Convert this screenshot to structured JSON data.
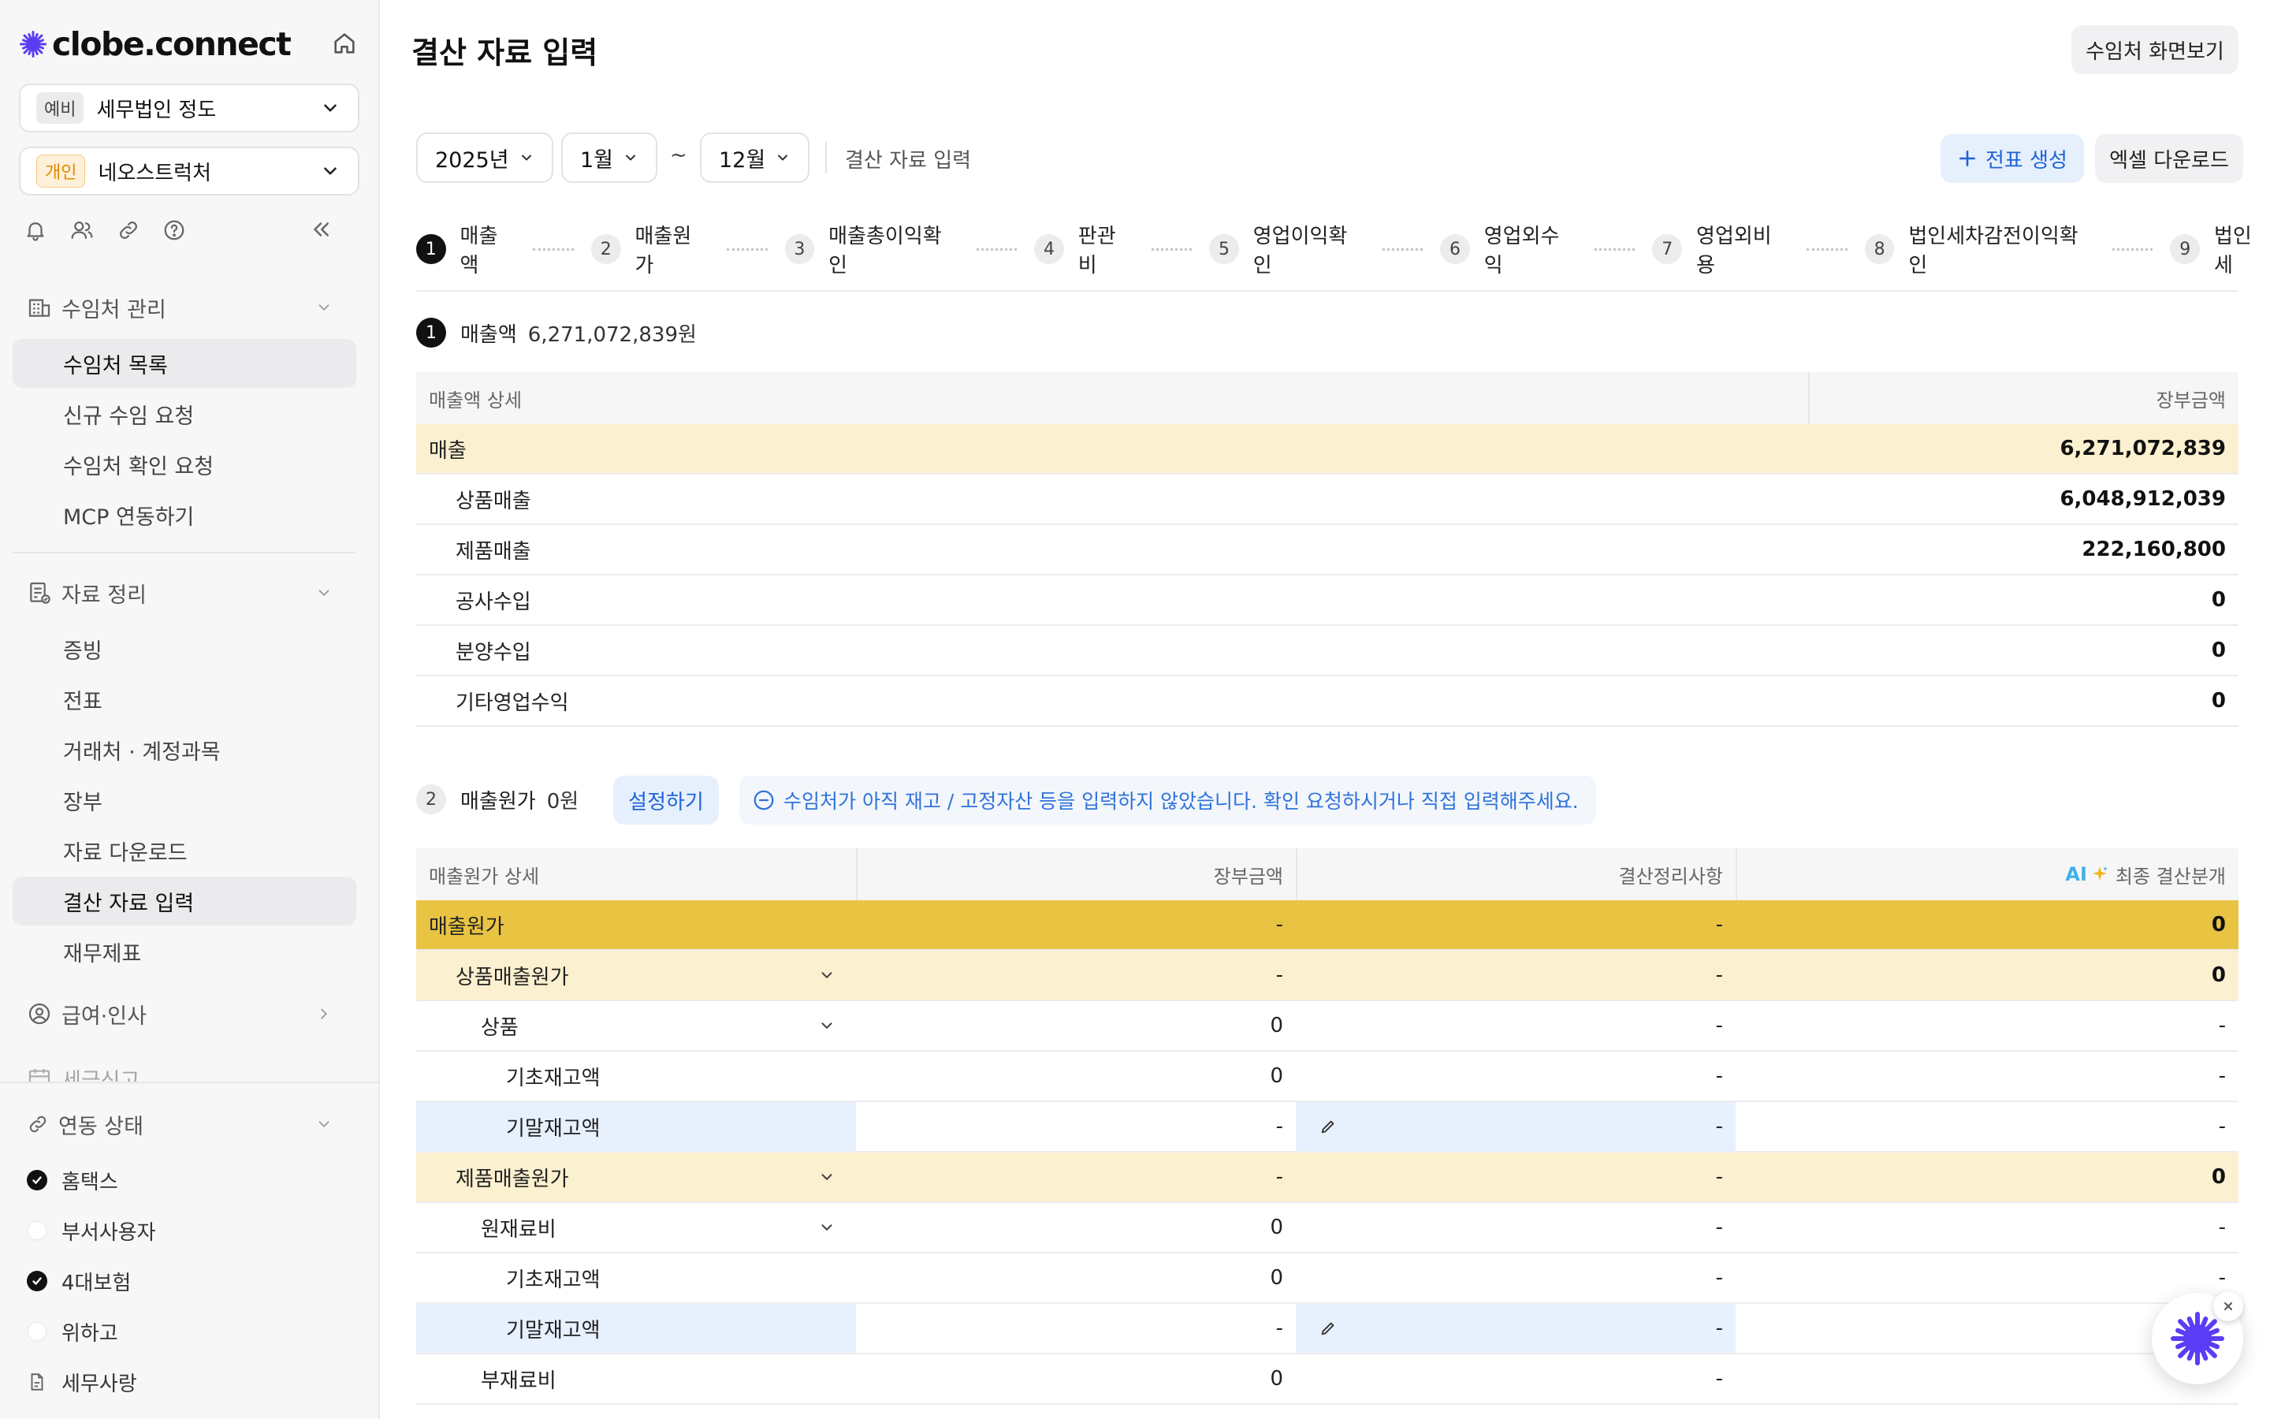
{
  "brand": {
    "logo_text": "clobe.connect",
    "accent": "#5b3df5"
  },
  "sidebar": {
    "workspace": {
      "tag": "예비",
      "name": "세무법인 정도"
    },
    "client": {
      "tag": "개인",
      "name": "네오스트럭처"
    },
    "sections": [
      {
        "label": "수임처 관리",
        "items": [
          "수임처 목록",
          "신규 수임 요청",
          "수임처 확인 요청",
          "MCP 연동하기"
        ]
      },
      {
        "label": "자료 정리",
        "items": [
          "증빙",
          "전표",
          "거래처 · 계정과목",
          "장부",
          "자료 다운로드",
          "결산 자료 입력",
          "재무제표"
        ]
      },
      {
        "label": "급여·인사"
      },
      {
        "label": "세금신고"
      }
    ],
    "connection": {
      "label": "연동 상태",
      "items": [
        {
          "label": "홈택스",
          "on": true
        },
        {
          "label": "부서사용자",
          "on": false
        },
        {
          "label": "4대보험",
          "on": true
        },
        {
          "label": "위하고",
          "on": false
        },
        {
          "label": "세무사랑",
          "on": null
        }
      ]
    }
  },
  "header": {
    "title": "결산 자료 입력",
    "client_view_button": "수임처 화면보기"
  },
  "filters": {
    "year": "2025년",
    "from_month": "1월",
    "tilde": "~",
    "to_month": "12월",
    "crumb": "결산 자료 입력",
    "create_voucher": "전표 생성",
    "excel_download": "엑셀 다운로드"
  },
  "steps": [
    {
      "num": "1",
      "label": "매출액",
      "current": true
    },
    {
      "num": "2",
      "label": "매출원가"
    },
    {
      "num": "3",
      "label": "매출총이익확인"
    },
    {
      "num": "4",
      "label": "판관비"
    },
    {
      "num": "5",
      "label": "영업이익확인"
    },
    {
      "num": "6",
      "label": "영업외수익"
    },
    {
      "num": "7",
      "label": "영업외비용"
    },
    {
      "num": "8",
      "label": "법인세차감전이익확인"
    },
    {
      "num": "9",
      "label": "법인세"
    }
  ],
  "revenue": {
    "num": "1",
    "title": "매출액",
    "amount": "6,271,072,839원",
    "col_detail": "매출액 상세",
    "col_book": "장부금액",
    "rows": [
      {
        "label": "매출",
        "value": "6,271,072,839"
      },
      {
        "label": "상품매출",
        "value": "6,048,912,039"
      },
      {
        "label": "제품매출",
        "value": "222,160,800"
      },
      {
        "label": "공사수입",
        "value": "0"
      },
      {
        "label": "분양수입",
        "value": "0"
      },
      {
        "label": "기타영업수익",
        "value": "0"
      }
    ]
  },
  "cogs": {
    "num": "2",
    "title": "매출원가",
    "amount": "0원",
    "set_button": "설정하기",
    "notice": "수임처가 아직 재고 / 고정자산 등을 입력하지 않았습니다. 확인 요청하시거나 직접 입력해주세요.",
    "col_detail": "매출원가 상세",
    "col_book": "장부금액",
    "col_adjust": "결산정리사항",
    "col_final_ai": "AI",
    "col_final": "최종 결산분개",
    "rows": [
      {
        "label": "매출원가",
        "book": "-",
        "adjust": "-",
        "final": "0"
      },
      {
        "label": "상품매출원가",
        "book": "-",
        "adjust": "-",
        "final": "0"
      },
      {
        "label": "상품",
        "book": "0",
        "adjust": "-",
        "final": "-"
      },
      {
        "label": "기초재고액",
        "book": "0",
        "adjust": "-",
        "final": "-"
      },
      {
        "label": "기말재고액",
        "book": "-",
        "adjust": "-",
        "final": "-"
      },
      {
        "label": "제품매출원가",
        "book": "-",
        "adjust": "-",
        "final": "0"
      },
      {
        "label": "원재료비",
        "book": "0",
        "adjust": "-",
        "final": "-"
      },
      {
        "label": "기초재고액",
        "book": "0",
        "adjust": "-",
        "final": "-"
      },
      {
        "label": "기말재고액",
        "book": "-",
        "adjust": "-",
        "final": ""
      },
      {
        "label": "부재료비",
        "book": "0",
        "adjust": "-",
        "final": ""
      }
    ]
  }
}
